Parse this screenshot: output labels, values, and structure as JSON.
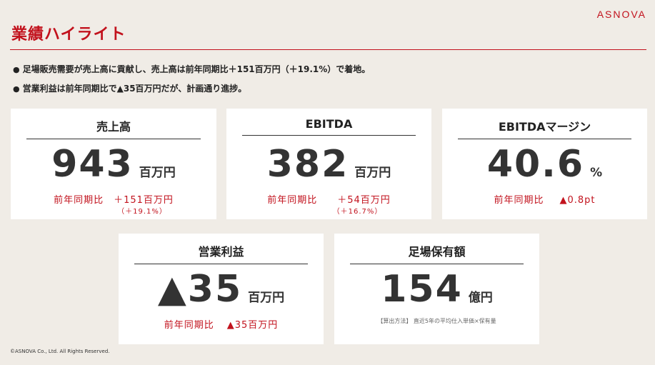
{
  "brand": "ASNOVA",
  "title": "業績ハイライト",
  "bullets": [
    "足場販売需要が売上高に貢献し、売上高は前年同期比＋151百万円（＋19.1%）で着地。",
    "営業利益は前年同期比で▲35百万円だが、計画通り進捗。"
  ],
  "cards": {
    "sales": {
      "label": "売上高",
      "value": "943",
      "unit": "百万円",
      "compare_label": "前年同期比",
      "compare_value": "＋151百万円",
      "compare_sub": "（＋19.1%）"
    },
    "ebitda": {
      "label": "EBITDA",
      "value": "382",
      "unit": "百万円",
      "compare_label": "前年同期比",
      "compare_value": "＋54百万円",
      "compare_sub": "（＋16.7%）"
    },
    "margin": {
      "label": "EBITDAマージン",
      "value": "40.6",
      "unit": "%",
      "compare_label": "前年同期比",
      "compare_value": "▲0.8pt"
    },
    "op_profit": {
      "label": "営業利益",
      "value": "▲35",
      "unit": "百万円",
      "compare_label": "前年同期比",
      "compare_value": "▲35百万円"
    },
    "scaffold": {
      "label": "足場保有額",
      "value": "154",
      "unit": "億円",
      "note": "【算出方法】 直近5年の平均仕入単価×保有量"
    }
  },
  "copyright": "©ASNOVA Co., Ltd. All Rights Reserved."
}
